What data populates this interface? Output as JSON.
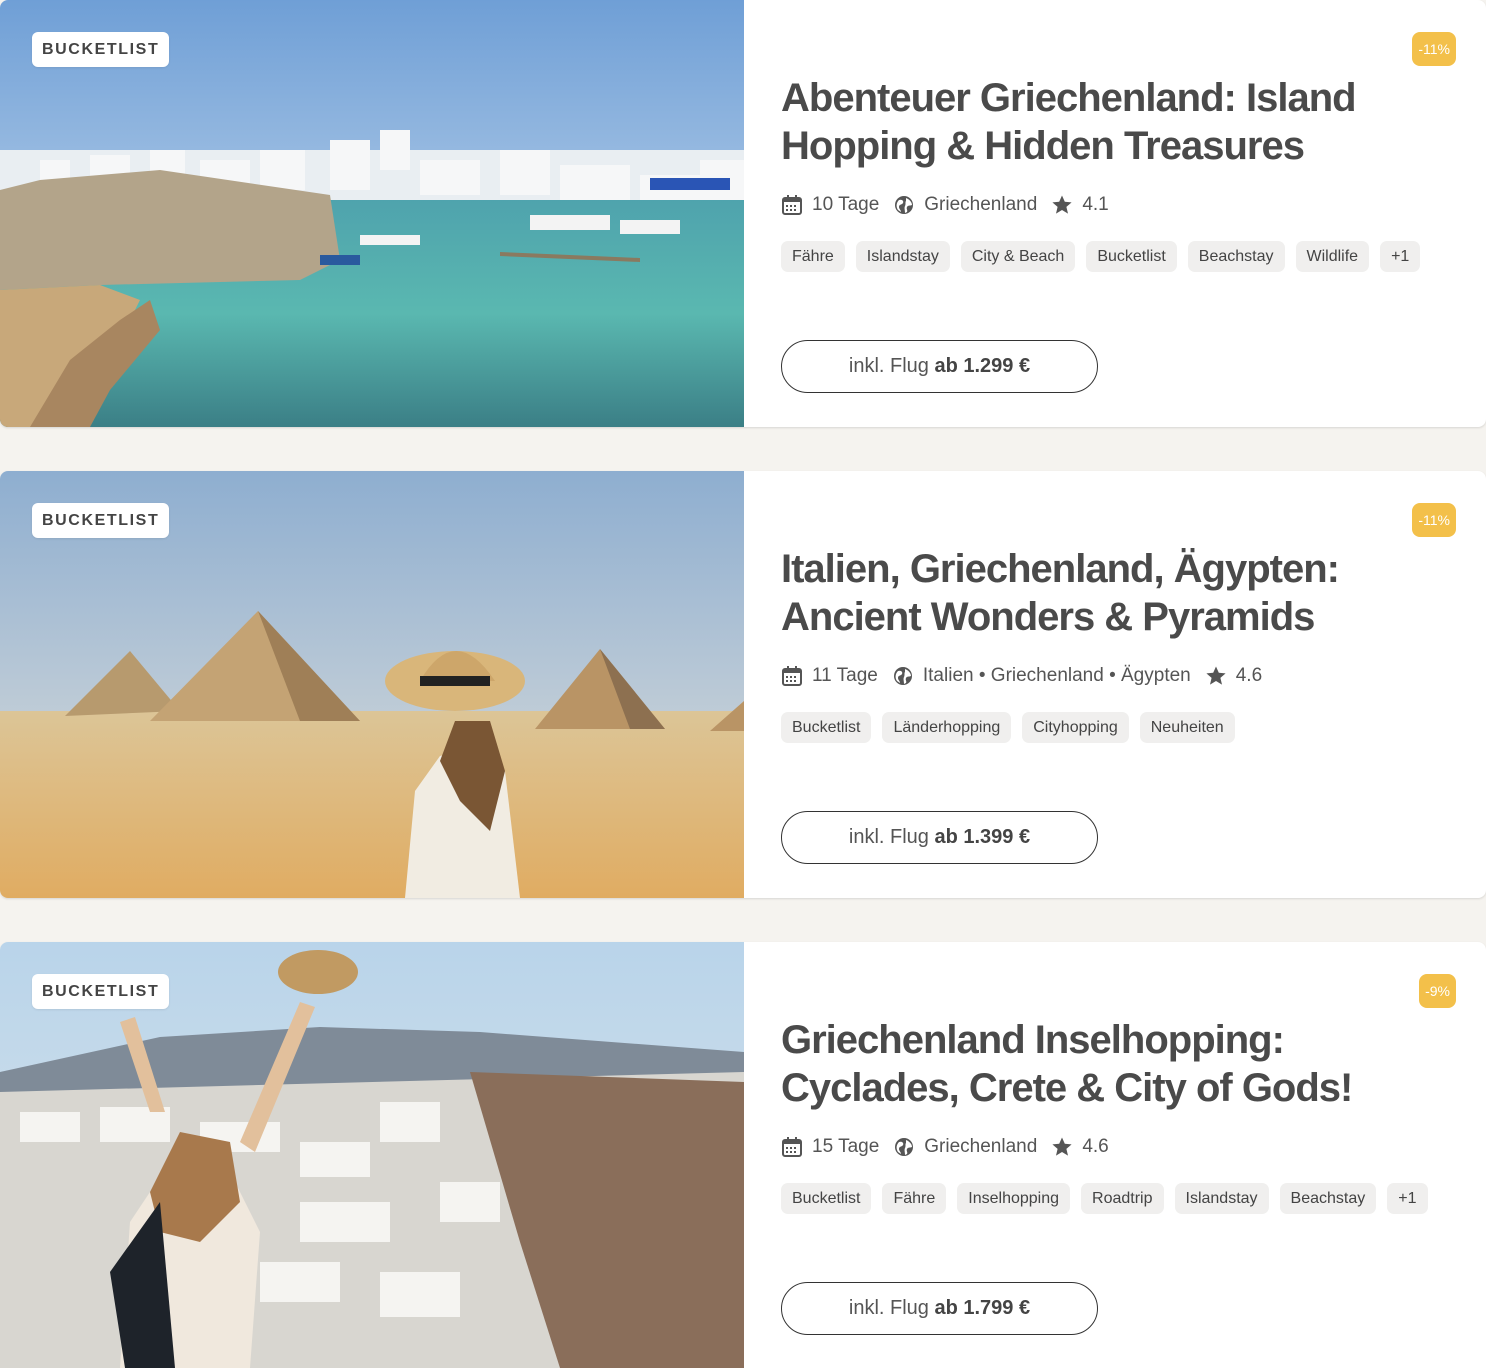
{
  "cards": [
    {
      "tag": "BUCKETLIST",
      "image_alt": "harbor-island",
      "discount": "-11%",
      "title": "Abenteuer Griechenland: Island Hopping & Hidden Treasures",
      "duration": "10 Tage",
      "destination": "Griechenland",
      "rating": "4.1",
      "tags": [
        "Fähre",
        "Islandstay",
        "City & Beach",
        "Bucketlist",
        "Beachstay",
        "Wildlife",
        "+1"
      ],
      "price_prefix": "inkl. Flug",
      "price_value": "ab 1.299 €"
    },
    {
      "tag": "BUCKETLIST",
      "image_alt": "pyramids",
      "discount": "-11%",
      "title": "Italien, Griechenland, Ägypten: Ancient Wonders & Pyramids",
      "duration": "11 Tage",
      "destination": "Italien • Griechenland • Ägypten",
      "rating": "4.6",
      "tags": [
        "Bucketlist",
        "Länderhopping",
        "Cityhopping",
        "Neuheiten"
      ],
      "price_prefix": "inkl. Flug",
      "price_value": "ab 1.399 €"
    },
    {
      "tag": "BUCKETLIST",
      "image_alt": "santorini",
      "discount": "-9%",
      "title": "Griechenland Inselhopping: Cyclades, Crete & City of Gods!",
      "duration": "15 Tage",
      "destination": "Griechenland",
      "rating": "4.6",
      "tags": [
        "Bucketlist",
        "Fähre",
        "Inselhopping",
        "Roadtrip",
        "Islandstay",
        "Beachstay",
        "+1"
      ],
      "price_prefix": "inkl. Flug",
      "price_value": "ab 1.799 €"
    }
  ],
  "colors": {
    "discount": "#f3c04a",
    "page_bg": "#f5f3ef",
    "text": "#4a4a4a"
  },
  "icons": {
    "duration": "calendar-icon",
    "destination": "globe-icon",
    "rating": "star-icon"
  }
}
